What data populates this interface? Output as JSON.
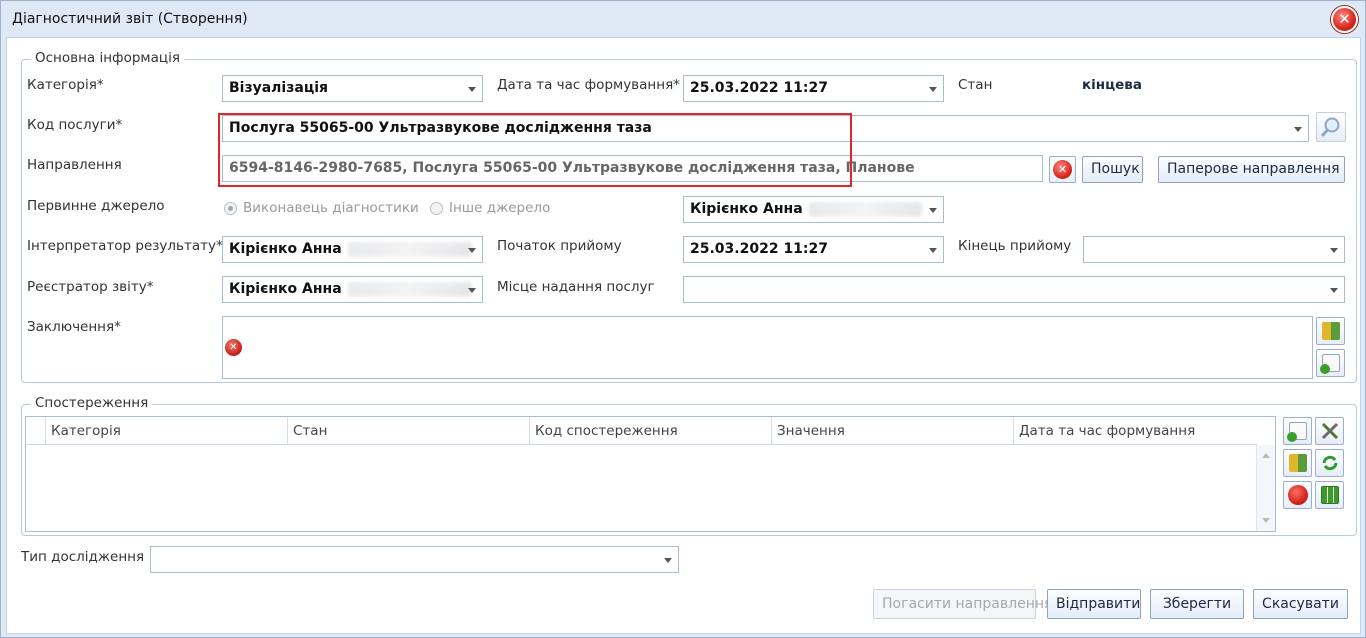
{
  "window": {
    "title": "Діагностичний звіт (Створення)"
  },
  "main_group": {
    "legend": "Основна інформація",
    "category_label": "Категорія*",
    "category_value": "Візуалізація",
    "date_label": "Дата та час формування*",
    "date_value": "25.03.2022 11:27",
    "state_label": "Стан",
    "state_value": "кінцева",
    "service_code_label": "Код послуги*",
    "service_code_value": "Послуга 55065-00 Ультразвукове дослідження таза",
    "referral_label": "Направлення",
    "referral_value": "6594-8146-2980-7685, Послуга 55065-00 Ультразвукове дослідження таза, Планове",
    "search_button": "Пошук",
    "paper_referral_button": "Паперове направлення",
    "primary_source_label": "Первинне джерело",
    "radio_executor": "Виконавець діагностики",
    "radio_other": "Інше джерело",
    "primary_source_person": "Кірієнко Анна",
    "interpreter_label": "Інтерпретатор результату*",
    "interpreter_value": "Кірієнко Анна",
    "reception_start_label": "Початок прийому",
    "reception_start_value": "25.03.2022 11:27",
    "reception_end_label": "Кінець прийому",
    "reception_end_value": "",
    "registrar_label": "Реєстратор звіту*",
    "registrar_value": "Кірієнко Анна",
    "service_place_label": "Місце надання послуг",
    "service_place_value": "",
    "conclusion_label": "Заключення*"
  },
  "observations": {
    "legend": "Спостереження",
    "columns": [
      "Категорія",
      "Стан",
      "Код спостереження",
      "Значення",
      "Дата та час формування"
    ]
  },
  "study_type_label": "Тип дослідження",
  "study_type_value": "",
  "footer": {
    "cancel_referral": "Погасити направлення",
    "send": "Відправити",
    "save": "Зберегти",
    "cancel": "Скасувати"
  },
  "colors": {
    "highlight": "#e0262d",
    "accent": "#1e2a44"
  }
}
